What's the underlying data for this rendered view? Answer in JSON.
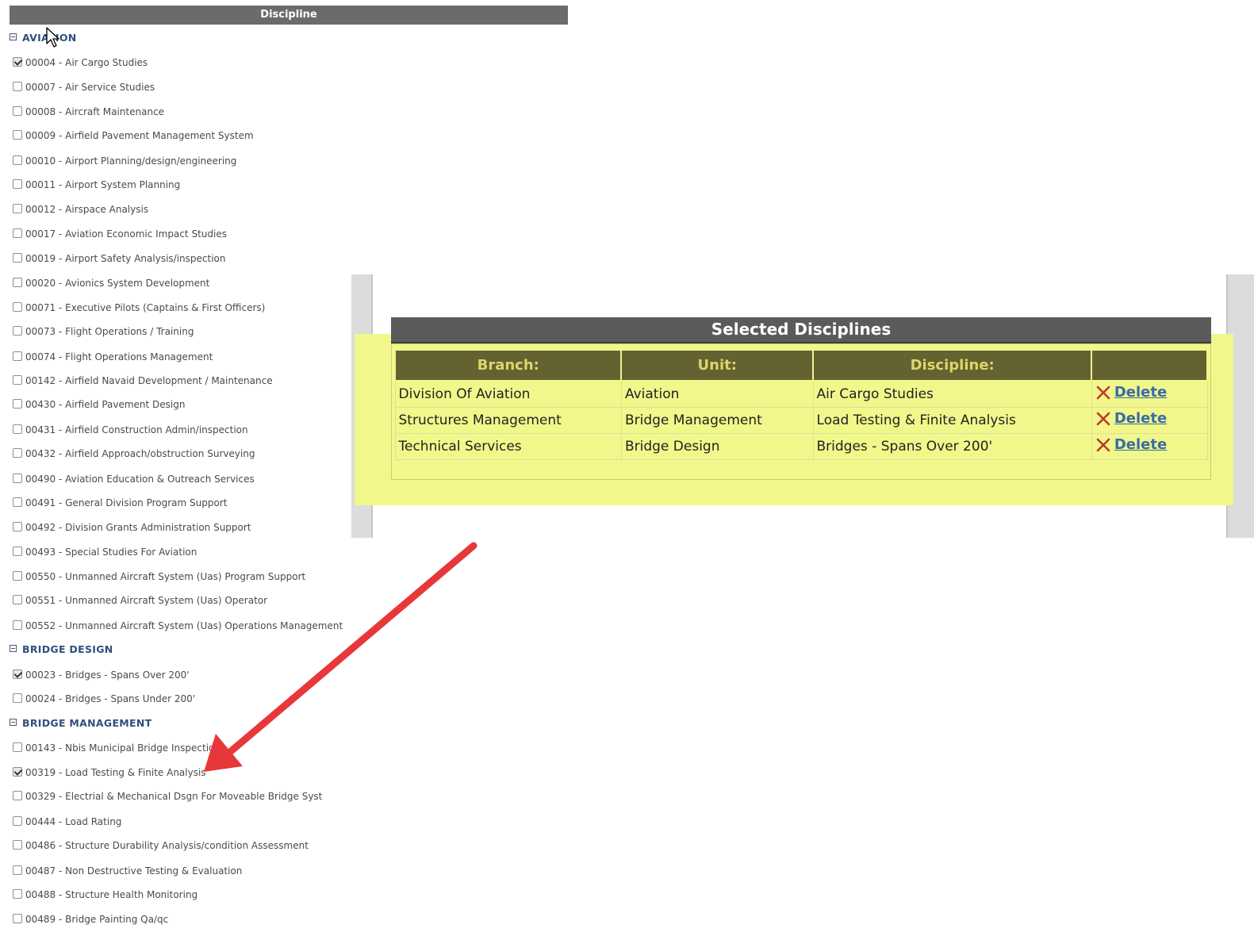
{
  "discipline_header": "Discipline",
  "groups": [
    {
      "name": "AVIATION",
      "items": [
        {
          "label": "00004 - Air Cargo Studies",
          "checked": true
        },
        {
          "label": "00007 - Air Service Studies",
          "checked": false
        },
        {
          "label": "00008 - Aircraft Maintenance",
          "checked": false
        },
        {
          "label": "00009 - Airfield Pavement Management System",
          "checked": false
        },
        {
          "label": "00010 - Airport Planning/design/engineering",
          "checked": false
        },
        {
          "label": "00011 - Airport System Planning",
          "checked": false
        },
        {
          "label": "00012 - Airspace Analysis",
          "checked": false
        },
        {
          "label": "00017 - Aviation Economic Impact Studies",
          "checked": false
        },
        {
          "label": "00019 - Airport Safety Analysis/inspection",
          "checked": false
        },
        {
          "label": "00020 - Avionics System Development",
          "checked": false
        },
        {
          "label": "00071 - Executive Pilots (Captains & First Officers)",
          "checked": false
        },
        {
          "label": "00073 - Flight Operations / Training",
          "checked": false
        },
        {
          "label": "00074 - Flight Operations Management",
          "checked": false
        },
        {
          "label": "00142 - Airfield Navaid Development / Maintenance",
          "checked": false
        },
        {
          "label": "00430 - Airfield Pavement Design",
          "checked": false
        },
        {
          "label": "00431 - Airfield Construction Admin/inspection",
          "checked": false
        },
        {
          "label": "00432 - Airfield Approach/obstruction Surveying",
          "checked": false
        },
        {
          "label": "00490 - Aviation Education & Outreach Services",
          "checked": false
        },
        {
          "label": "00491 - General Division Program Support",
          "checked": false
        },
        {
          "label": "00492 - Division Grants Administration Support",
          "checked": false
        },
        {
          "label": "00493 - Special Studies For Aviation",
          "checked": false
        },
        {
          "label": "00550 - Unmanned Aircraft System (Uas) Program Support",
          "checked": false
        },
        {
          "label": "00551 - Unmanned Aircraft System (Uas) Operator",
          "checked": false
        },
        {
          "label": "00552 - Unmanned Aircraft System (Uas) Operations Management",
          "checked": false
        }
      ]
    },
    {
      "name": "BRIDGE DESIGN",
      "items": [
        {
          "label": "00023 - Bridges - Spans Over 200'",
          "checked": true
        },
        {
          "label": "00024 - Bridges - Spans Under 200'",
          "checked": false
        }
      ]
    },
    {
      "name": "BRIDGE MANAGEMENT",
      "items": [
        {
          "label": "00143 - Nbis Municipal Bridge Inspection",
          "checked": false
        },
        {
          "label": "00319 - Load Testing & Finite Analysis",
          "checked": true
        },
        {
          "label": "00329 - Electrial & Mechanical Dsgn For Moveable Bridge Syst",
          "checked": false
        },
        {
          "label": "00444 - Load Rating",
          "checked": false
        },
        {
          "label": "00486 - Structure Durability Analysis/condition Assessment",
          "checked": false
        },
        {
          "label": "00487 - Non Destructive Testing & Evaluation",
          "checked": false
        },
        {
          "label": "00488 - Structure Health Monitoring",
          "checked": false
        },
        {
          "label": "00489 - Bridge Painting Qa/qc",
          "checked": false
        }
      ]
    }
  ],
  "selected": {
    "title": "Selected Disciplines",
    "columns": [
      "Branch:",
      "Unit:",
      "Discipline:",
      ""
    ],
    "rows": [
      {
        "branch": "Division Of Aviation",
        "unit": "Aviation",
        "discipline": "Air Cargo Studies",
        "action": "Delete"
      },
      {
        "branch": "Structures Management",
        "unit": "Bridge Management",
        "discipline": "Load Testing & Finite Analysis",
        "action": "Delete"
      },
      {
        "branch": "Technical Services",
        "unit": "Bridge Design",
        "discipline": "Bridges - Spans Over 200'",
        "action": "Delete"
      }
    ]
  },
  "colors": {
    "header_gray": "#6b6b6b",
    "highlight_yellow": "#f1f78a",
    "table_header_bg": "#646231",
    "table_header_text": "#dcd66a",
    "delete_blue": "#3b6aa8",
    "delete_x_red": "#c0392b",
    "arrow_red": "#e8373a"
  }
}
